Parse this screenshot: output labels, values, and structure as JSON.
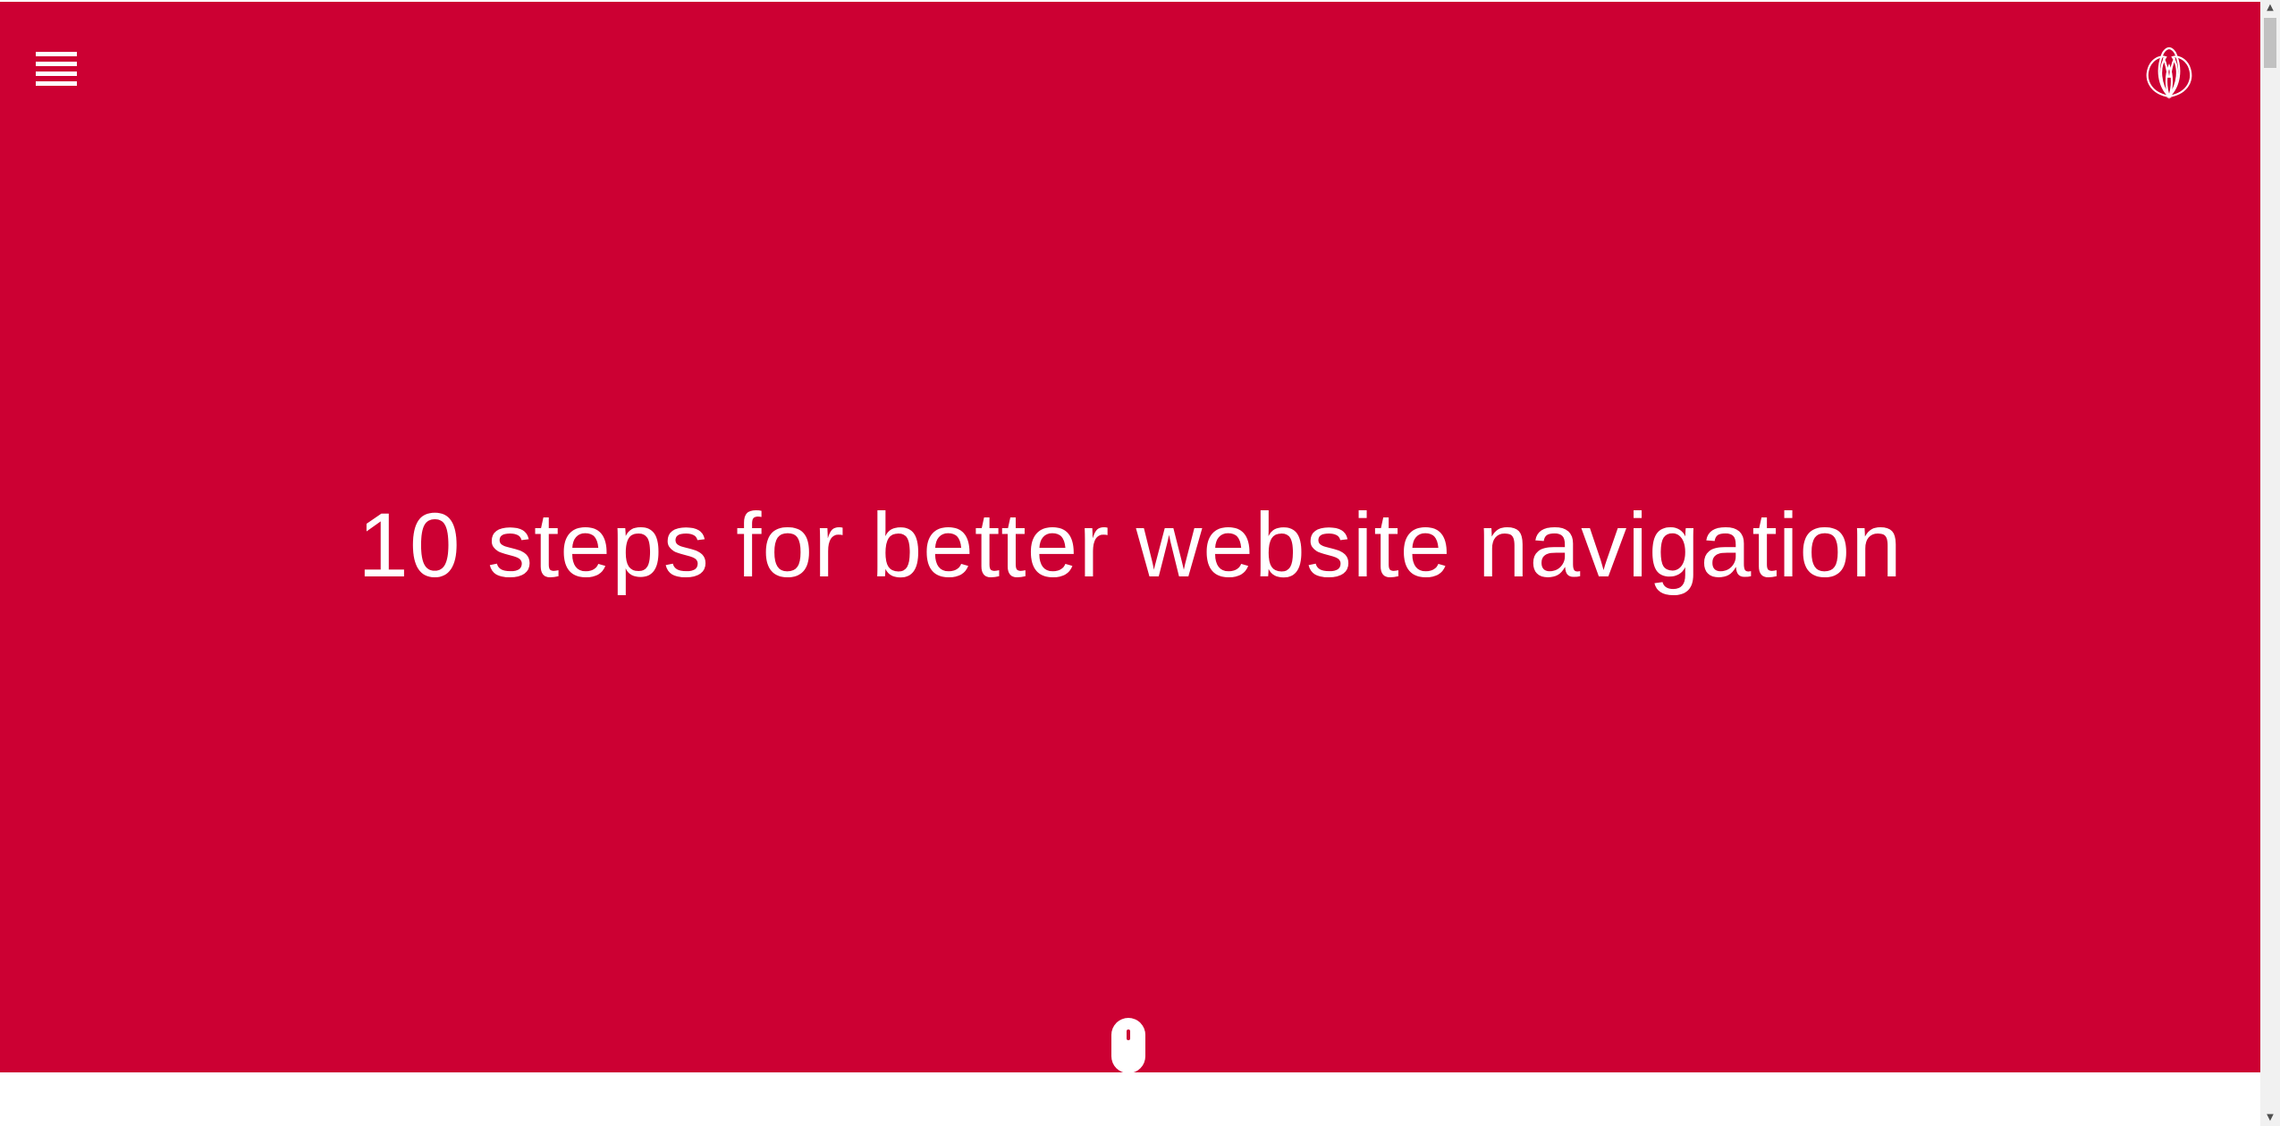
{
  "hero": {
    "title": "10 steps for better website navigation",
    "background_color": "#cc0033",
    "text_color": "#ffffff"
  },
  "header": {
    "menu_icon": "hamburger-menu-icon",
    "logo_icon": "lotus-flower-logo-icon"
  },
  "scroll_indicator": {
    "icon": "mouse-scroll-icon"
  },
  "scrollbar": {
    "up_arrow": "▲",
    "down_arrow": "▼",
    "position": 0
  }
}
